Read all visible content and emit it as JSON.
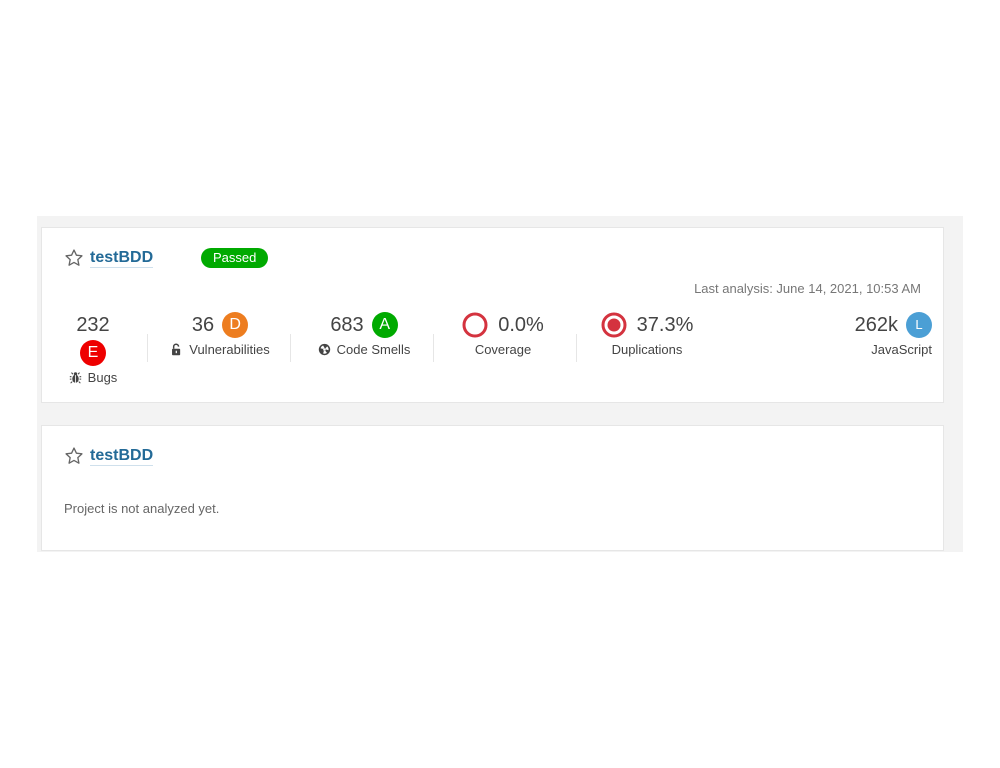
{
  "projects": [
    {
      "name": "testBDD",
      "quality_gate": "Passed",
      "last_analysis": "Last analysis: June 14, 2021, 10:53 AM",
      "measures": {
        "bugs": {
          "value": "232",
          "rating": "E",
          "label": "Bugs"
        },
        "vulnerabilities": {
          "value": "36",
          "rating": "D",
          "label": "Vulnerabilities"
        },
        "code_smells": {
          "value": "683",
          "rating": "A",
          "label": "Code Smells"
        },
        "coverage": {
          "value": "0.0%",
          "label": "Coverage"
        },
        "duplications": {
          "value": "37.3%",
          "label": "Duplications"
        },
        "size": {
          "value": "262k",
          "rating": "L",
          "label": "JavaScript"
        }
      }
    },
    {
      "name": "testBDD",
      "status_text": "Project is not analyzed yet."
    }
  ],
  "colors": {
    "rating_E": "#ee0000",
    "rating_D": "#ed7d20",
    "rating_A": "#00aa00",
    "size_badge": "#4b9fd5",
    "link": "#236a97",
    "gate_passed": "#00aa00",
    "coverage_ring": "#d4333f"
  },
  "icons": {
    "star": "star-icon",
    "bug": "bug-icon",
    "lock": "unlocked-lock-icon",
    "code_smell": "radiation-icon"
  }
}
